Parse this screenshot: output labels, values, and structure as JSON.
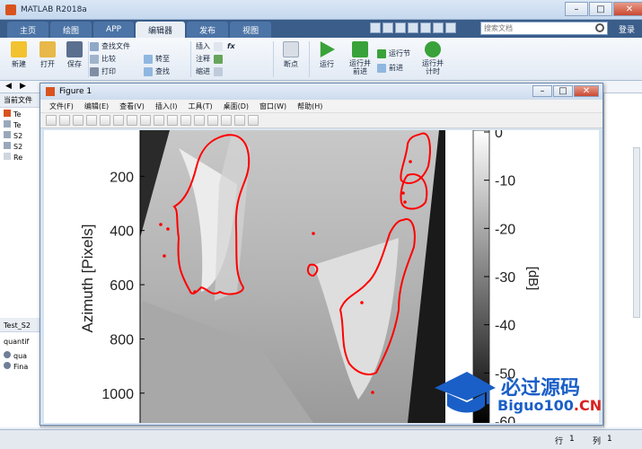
{
  "window": {
    "title": "MATLAB R2018a"
  },
  "tabs": [
    {
      "label": "主页",
      "active": false
    },
    {
      "label": "绘图",
      "active": false
    },
    {
      "label": "APP",
      "active": false
    },
    {
      "label": "编辑器",
      "active": true
    },
    {
      "label": "发布",
      "active": false
    },
    {
      "label": "视图",
      "active": false
    }
  ],
  "search": {
    "placeholder": "搜索文档"
  },
  "login": "登录",
  "ribbon": {
    "new": "新建",
    "open": "打开",
    "save": "保存",
    "find_files": "查找文件",
    "compare": "比较",
    "print": "打印",
    "goto": "转至",
    "find": "查找",
    "insert": "插入",
    "comment": "注释",
    "indent": "缩进",
    "breakpoints": "断点",
    "run": "运行",
    "run_advance": [
      "运行并",
      "前进"
    ],
    "run_section": "运行节",
    "advance": "前进",
    "run_time": [
      "运行并",
      "计时"
    ]
  },
  "panels": {
    "current_folder": "当前文件",
    "files": [
      "Te",
      "Te",
      "S2",
      "S2",
      "Re"
    ],
    "bottom_title": "Test_S2",
    "bottom_text": "quantif",
    "bottom_items": [
      "qua",
      "Fina"
    ]
  },
  "status": {
    "row_label": "行",
    "row": "1",
    "col_label": "列",
    "col": "1"
  },
  "figure": {
    "title": "Figure 1",
    "menu": [
      "文件(F)",
      "编辑(E)",
      "查看(V)",
      "插入(I)",
      "工具(T)",
      "桌面(D)",
      "窗口(W)",
      "帮助(H)"
    ]
  },
  "chart_data": {
    "type": "heatmap",
    "ylabel": "Azimuth [Pixels]",
    "yticks": [
      200,
      400,
      600,
      800,
      1000
    ],
    "ylim": [
      30,
      1110
    ],
    "colorbar": {
      "label": "[dB]",
      "ticks": [
        0,
        -10,
        -20,
        -30,
        -40,
        -50,
        -60
      ],
      "range": [
        -60,
        0
      ]
    },
    "contour_color": "#ff0000",
    "grid": false
  },
  "watermark": {
    "title": "必过源码",
    "sub_a": "Biguo100",
    "sub_b": ".CN"
  }
}
